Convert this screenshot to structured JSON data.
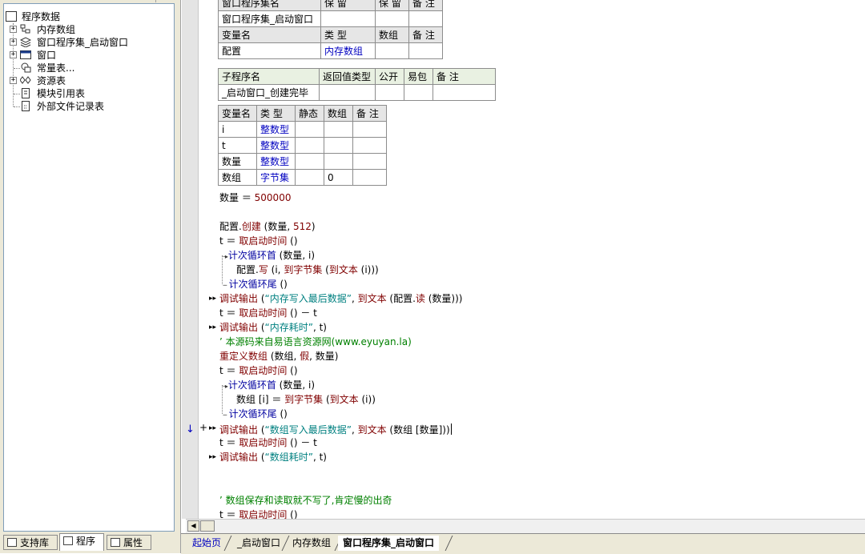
{
  "tree": {
    "root": "程序数据",
    "items": [
      {
        "label": "内存数组",
        "icon": "module-icon",
        "expander": "+"
      },
      {
        "label": "窗口程序集_启动窗口",
        "icon": "assembly-icon",
        "expander": "+"
      },
      {
        "label": "窗口",
        "icon": "window-icon",
        "expander": "+"
      },
      {
        "label": "常量表...",
        "icon": "constant-icon",
        "expander": ""
      },
      {
        "label": "资源表",
        "icon": "resource-icon",
        "expander": "+"
      },
      {
        "label": "模块引用表",
        "icon": "module-ref-icon",
        "expander": ""
      },
      {
        "label": "外部文件记录表",
        "icon": "external-file-icon",
        "expander": ""
      }
    ]
  },
  "left_tabs": [
    "支持库",
    "程序",
    "属性"
  ],
  "assembly_table": {
    "headers": [
      "窗口程序集名",
      "保 留",
      "保 留",
      "备 注"
    ],
    "row": [
      "窗口程序集_启动窗口",
      "",
      "",
      ""
    ],
    "var_headers": [
      "变量名",
      "类 型",
      "数组",
      "备 注"
    ],
    "var_row": [
      "配置",
      "内存数组",
      "",
      ""
    ]
  },
  "sub_table": {
    "headers": [
      "子程序名",
      "返回值类型",
      "公开",
      "易包",
      "备 注"
    ],
    "row": [
      "_启动窗口_创建完毕",
      "",
      "",
      "",
      ""
    ]
  },
  "local_table": {
    "headers": [
      "变量名",
      "类 型",
      "静态",
      "数组",
      "备 注"
    ],
    "rows": [
      [
        "i",
        "整数型",
        "",
        "",
        ""
      ],
      [
        "t",
        "整数型",
        "",
        "",
        ""
      ],
      [
        "数量",
        "整数型",
        "",
        "",
        ""
      ],
      [
        "数组",
        "字节集",
        "",
        "0",
        ""
      ]
    ]
  },
  "code": {
    "l1a": "数量",
    "l1b": " ＝ ",
    "l1c": "500000",
    "l2a": "配置.",
    "l2b": "创建",
    "l2c": " (数量, ",
    "l2d": "512",
    "l2e": ")",
    "l3a": "t ＝ ",
    "l3b": "取启动时间",
    "l3c": " ()",
    "l4a": "计次循环首",
    "l4b": " (数量, i)",
    "l5a": "配置.",
    "l5b": "写",
    "l5c": " (i, ",
    "l5d": "到字节集",
    "l5e": " (",
    "l5f": "到文本",
    "l5g": " (i)))",
    "l6a": "计次循环尾",
    "l6b": " ()",
    "l7a": "调试输出",
    "l7b": " (",
    "l7c": "“内存写入最后数据”",
    "l7d": ", ",
    "l7e": "到文本",
    "l7f": " (配置.",
    "l7g": "读",
    "l7h": " (数量)))",
    "l8a": "t ＝ ",
    "l8b": "取启动时间",
    "l8c": " () － t",
    "l9a": "调试输出",
    "l9b": " (",
    "l9c": "“内存耗时”",
    "l9d": ", t)",
    "l10": "’ 本源码来自易语言资源网(www.eyuyan.la)",
    "l11a": "重定义数组",
    "l11b": " (数组, ",
    "l11c": "假",
    "l11d": ", 数量)",
    "l12a": "t ＝ ",
    "l12b": "取启动时间",
    "l12c": " ()",
    "l13a": "计次循环首",
    "l13b": " (数量, i)",
    "l14a": "数组 [i] ＝ ",
    "l14b": "到字节集",
    "l14c": " (",
    "l14d": "到文本",
    "l14e": " (i))",
    "l15a": "计次循环尾",
    "l15b": " ()",
    "l16a": "调试输出",
    "l16b": " (",
    "l16c": "“数组写入最后数据”",
    "l16d": ", ",
    "l16e": "到文本",
    "l16f": " (数组 [数量]))",
    "l17a": "t ＝ ",
    "l17b": "取启动时间",
    "l17c": " () － t",
    "l18a": "调试输出",
    "l18b": " (",
    "l18c": "“数组耗时”",
    "l18d": ", t)",
    "l19": "’ 数组保存和读取就不写了,肯定慢的出奇",
    "l20a": "t ＝ ",
    "l20b": "取启动时间",
    "l20c": " ()"
  },
  "editor_tabs": [
    "起始页",
    "_启动窗口",
    "内存数组",
    "窗口程序集_启动窗口"
  ]
}
